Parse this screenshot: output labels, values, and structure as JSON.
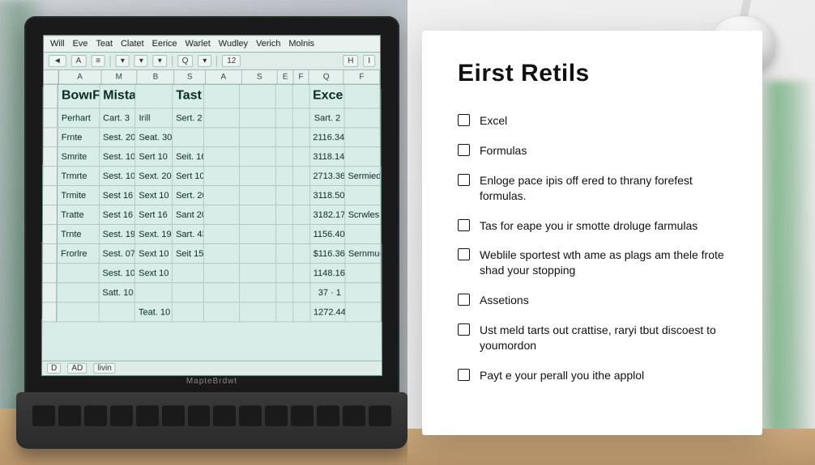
{
  "spreadsheet": {
    "brand": "MapteBrdwt",
    "menu": [
      "Will",
      "Eve",
      "Teat",
      "Clatet",
      "Eerice",
      "Warlet",
      "Wudley",
      "Verich",
      "Molnis"
    ],
    "toolbar": {
      "triangle": "◄",
      "A": "A",
      "align": "≡",
      "dropdown": "▾",
      "search": "Q",
      "n12": "12",
      "H": "H",
      "I": "I"
    },
    "col_headers": [
      "A",
      "M",
      "B",
      "S",
      "A",
      "S",
      "E",
      "F",
      "Q",
      "F"
    ],
    "title_cells": {
      "a": "BowıFiet",
      "b": "Mistalkes",
      "tast": "Tast",
      "excel": "Excel"
    },
    "rows": [
      {
        "name": "Perhart",
        "c2": "Cart. 3",
        "c3": "Irill",
        "c4": "Sert. 2",
        "q": "Sart. 2",
        "f": ""
      },
      {
        "name": "Frnte",
        "c2": "Sest. 20",
        "c3": "Seat. 30",
        "c4": "",
        "q": "2116.34",
        "f": ""
      },
      {
        "name": "Smrite",
        "c2": "Sest. 10",
        "c3": "Sert 10",
        "c4": "Seit. 16",
        "q": "3118.14",
        "f": ""
      },
      {
        "name": "Trmrte",
        "c2": "Sest. 10",
        "c3": "Sext. 20",
        "c4": "Sert 10",
        "q": "2713.36",
        "f": "Sermied"
      },
      {
        "name": "Trmite",
        "c2": "Sest 16",
        "c3": "Sext 10",
        "c4": "Sert. 20",
        "q": "3118.50",
        "f": ""
      },
      {
        "name": "Tratte",
        "c2": "Sest 16",
        "c3": "Sert 16",
        "c4": "Sant 20",
        "q": "3182.17",
        "f": "Scrwles"
      },
      {
        "name": "Trnte",
        "c2": "Sest. 19",
        "c3": "Sext. 19",
        "c4": "Sart. 43",
        "q": "1156.40",
        "f": ""
      },
      {
        "name": "Frorlre",
        "c2": "Sest. 07",
        "c3": "Sext 10",
        "c4": "Seit 15",
        "q": "$116.36",
        "f": "Sernmud"
      },
      {
        "name": "",
        "c2": "Sest. 10",
        "c3": "Sext 10",
        "c4": "",
        "q": "1148.16",
        "f": ""
      },
      {
        "name": "",
        "c2": "Satt. 10",
        "c3": "",
        "c4": "",
        "q": "37 · 1",
        "f": ""
      },
      {
        "name": "",
        "c2": "",
        "c3": "Teat. 10",
        "c4": "",
        "q": "1272.44",
        "f": ""
      }
    ],
    "status": {
      "D": "D",
      "AD": "AD",
      "livin": "livin"
    }
  },
  "checklist": {
    "title": "Eirst Retils",
    "items": [
      "Excel",
      "Formulas",
      "Enloge pace ipis off ered to thrany forefest formulas.",
      "Tas for eape you ir smotte droluge farmulas",
      "Weblile sportest wth ame as plags am thele frote shad your stopping",
      "Assetions",
      "Ust meld tarts out crattise, raryi tbut discoest to youmordon",
      "Payt e your perall you ithe applol"
    ]
  }
}
